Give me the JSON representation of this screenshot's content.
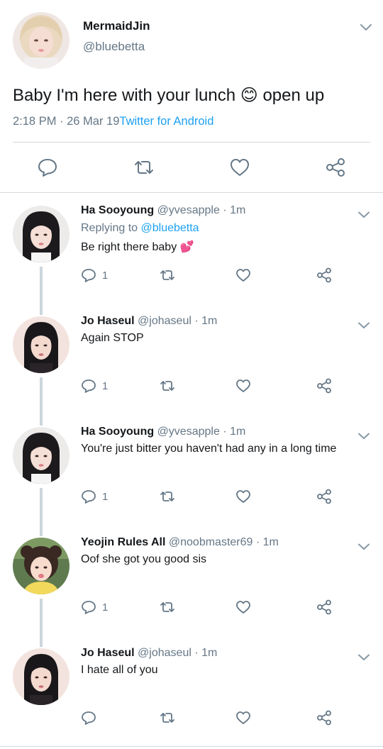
{
  "main_tweet": {
    "display_name": "MermaidJin",
    "handle": "@bluebetta",
    "text_before_emoji": "Baby I'm here with your lunch",
    "emoji": "😊",
    "text_after_emoji": "open up",
    "time": "2:18 PM · 26 Mar 19",
    "source": "Twitter for Android",
    "icons": [
      "reply-icon",
      "retweet-icon",
      "like-icon",
      "share-icon",
      "chevron-down-icon"
    ]
  },
  "replies": [
    {
      "name": "Ha Sooyoung",
      "handle": "@yvesapple",
      "time": "· 1m",
      "replying_prefix": "Replying to ",
      "replying_to": "@bluebetta",
      "text": "Be right there baby",
      "emoji": "💕",
      "reply_count": "1"
    },
    {
      "name": "Jo Haseul",
      "handle": "@johaseul",
      "time": "· 1m",
      "text": "Again STOP",
      "reply_count": "1"
    },
    {
      "name": "Ha Sooyoung",
      "handle": "@yvesapple",
      "time": "· 1m",
      "text": "You're just bitter you haven't had any in a long time",
      "reply_count": "1"
    },
    {
      "name": "Yeojin Rules All",
      "handle": "@noobmaster69",
      "time": "· 1m",
      "text": "Oof she got you good sis",
      "reply_count": "1"
    },
    {
      "name": "Jo Haseul",
      "handle": "@johaseul",
      "time": "· 1m",
      "text": "I hate all of you",
      "reply_count": ""
    }
  ],
  "colors": {
    "text": "#14171a",
    "secondary": "#657786",
    "link": "#1da1f2",
    "divider": "#d3d8dc",
    "thread_line": "#ccd6dd"
  }
}
